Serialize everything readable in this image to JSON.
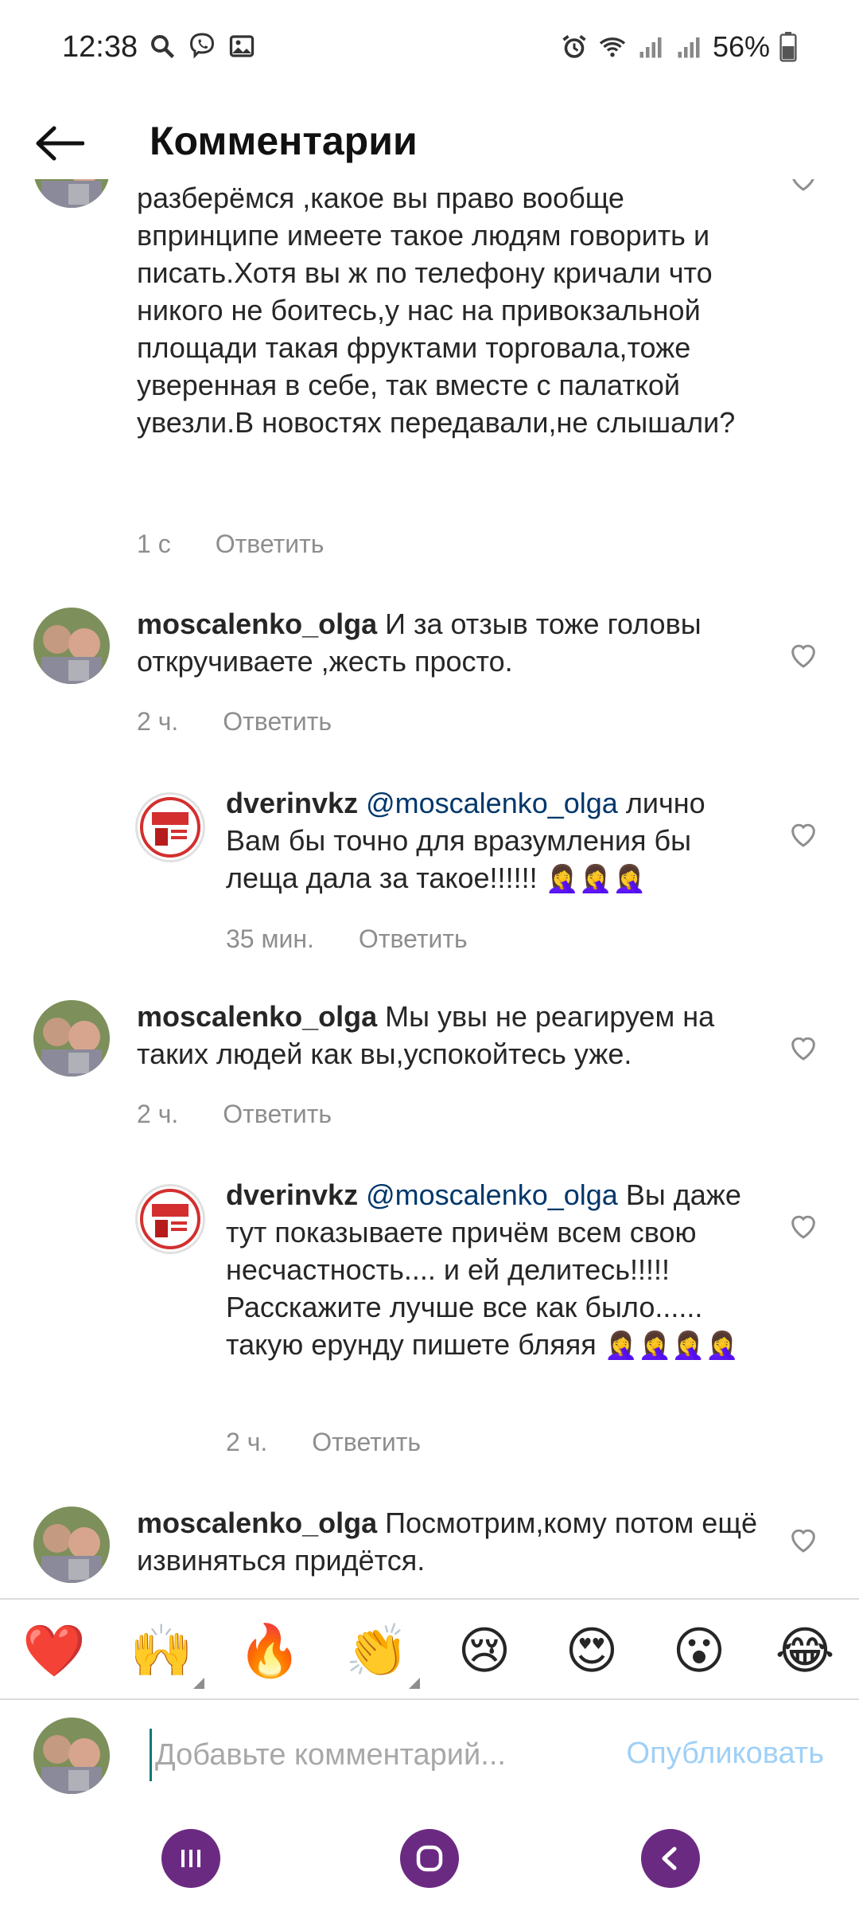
{
  "status": {
    "time": "12:38",
    "battery": "56%"
  },
  "header": {
    "title": "Комментарии"
  },
  "comments": [
    {
      "id": "c0",
      "user": "",
      "text": "разберёмся ,какое вы право вообще впринципе имеете такое людям говорить и писать.Хотя вы ж по телефону кричали что никого не боитесь,у нас на привокзальной площади такая фруктами торговала,тоже уверенная в себе, так вместе с палаткой увезли.В новостях передавали,не слышали?",
      "time": "1 с",
      "reply": "Ответить"
    },
    {
      "id": "c1",
      "user": "moscalenko_olga",
      "text": "И за отзыв тоже головы откручиваете ,жесть просто.",
      "time": "2 ч.",
      "reply": "Ответить"
    },
    {
      "id": "c2",
      "user": "dverinvkz",
      "mention": "@moscalenko_olga",
      "text": "лично Вам бы точно для вразумления бы леща дала за такое!!!!!!",
      "emoji": "🤦‍♀️🤦‍♀️🤦‍♀️",
      "time": "35 мин.",
      "reply": "Ответить"
    },
    {
      "id": "c3",
      "user": "moscalenko_olga",
      "text": "Мы увы не реагируем на таких людей как вы,успокойтесь уже.",
      "time": "2 ч.",
      "reply": "Ответить"
    },
    {
      "id": "c4",
      "user": "dverinvkz",
      "mention": "@moscalenko_olga",
      "text": "Вы даже тут показываете причём всем свою несчастность.... и ей делитесь!!!!! Расскажите лучше все как было...... такую ерунду пишете бляяя",
      "emoji": "🤦‍♀️🤦‍♀️🤦‍♀️🤦‍♀️",
      "time": "2 ч.",
      "reply": "Ответить"
    },
    {
      "id": "c5",
      "user": "moscalenko_olga",
      "text": "Посмотрим,кому потом ещё извиняться придётся.",
      "time": "",
      "reply": ""
    }
  ],
  "emoji_bar": [
    "❤️",
    "🙌",
    "🔥",
    "👏",
    "😢",
    "😍",
    "😮",
    "😂"
  ],
  "input": {
    "placeholder": "Добавьте комментарий...",
    "publish": "Опубликовать"
  },
  "colors": {
    "text": "#262626",
    "meta": "#8e8e8e",
    "mention": "#00376b",
    "publish_disabled": "#9fd0f6",
    "nav_button": "#6b2a82"
  }
}
